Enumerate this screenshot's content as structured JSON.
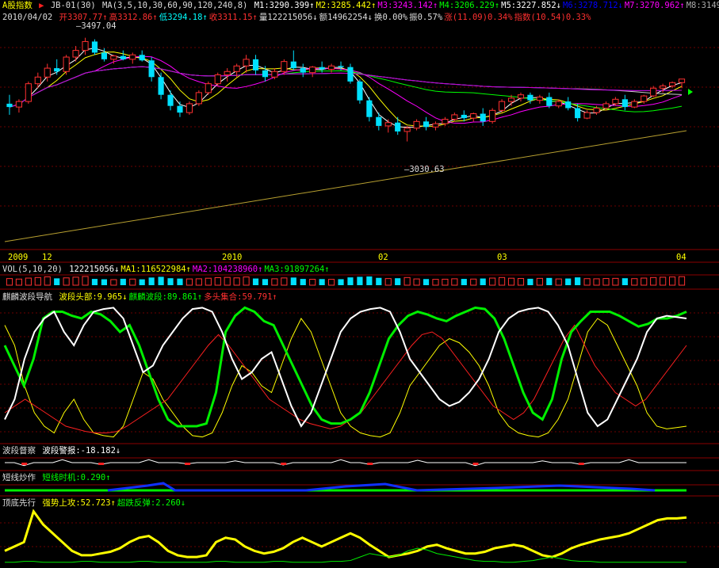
{
  "header": {
    "title": "A股指数",
    "formula": "JB-01(30)",
    "ma_label": "MA(3,5,10,30,60,90,120,240,8)",
    "ma_values": [
      {
        "text": "M1:3290.399",
        "arrow": "↑",
        "color": "#ffffff"
      },
      {
        "text": "M2:3285.442",
        "arrow": "↑",
        "color": "#ffff00"
      },
      {
        "text": "M3:3243.142",
        "arrow": "↑",
        "color": "#ff00ff"
      },
      {
        "text": "M4:3206.229",
        "arrow": "↑",
        "color": "#00ff00"
      },
      {
        "text": "M5:3227.852",
        "arrow": "↓",
        "color": "#ffffff"
      },
      {
        "text": "M6:3278.712",
        "arrow": "↓",
        "color": "#0000ff"
      },
      {
        "text": "M7:3270.962",
        "arrow": "↑",
        "color": "#ff00ff"
      },
      {
        "text": "M8:3149.",
        "arrow": "",
        "color": "#aaaaaa"
      }
    ],
    "date": "2010/04/02",
    "quote": [
      {
        "text": "开3307.77",
        "arrow": "↑",
        "color": "#ff3030"
      },
      {
        "text": "高3312.86",
        "arrow": "↑",
        "color": "#ff3030"
      },
      {
        "text": "低3294.18",
        "arrow": "↑",
        "color": "#00ffff"
      },
      {
        "text": "收3311.15",
        "arrow": "↑",
        "color": "#ff3030"
      },
      {
        "text": "量122215056",
        "arrow": "↓",
        "color": "#dddddd"
      },
      {
        "text": "额14962254",
        "arrow": "↓",
        "color": "#dddddd"
      },
      {
        "text": "换0.00%",
        "arrow": "",
        "color": "#dddddd"
      },
      {
        "text": "振0.57%",
        "arrow": "",
        "color": "#dddddd"
      },
      {
        "text": "涨(11.09)0.34%",
        "arrow": "",
        "color": "#ff3030"
      },
      {
        "text": "指数(10.54)0.33%",
        "arrow": "",
        "color": "#ff3030"
      }
    ]
  },
  "price_annotations": {
    "high": "3497.04",
    "low": "3030.63"
  },
  "time_axis": [
    "2009",
    "12",
    "2010",
    "02",
    "03",
    "04"
  ],
  "volume_panel": {
    "label": "VOL(5,10,20)",
    "items": [
      {
        "text": "122215056",
        "arrow": "↓",
        "color": "#ffffff"
      },
      {
        "text": "MA1:116522984",
        "arrow": "↑",
        "color": "#ffff00"
      },
      {
        "text": "MA2:104238960",
        "arrow": "↑",
        "color": "#ff00ff"
      },
      {
        "text": "MA3:91897264",
        "arrow": "↑",
        "color": "#00ff00"
      }
    ]
  },
  "wave_panel": {
    "label": "麒麟波段导航",
    "items": [
      {
        "text": "波段头部:9.965",
        "arrow": "↓",
        "color": "#ffff00"
      },
      {
        "text": "麒麟波段:89.861",
        "arrow": "↑",
        "color": "#00ff00"
      },
      {
        "text": "多头集合:59.791",
        "arrow": "↑",
        "color": "#ff3030"
      }
    ]
  },
  "watch_panel": {
    "label": "波段督察",
    "items": [
      {
        "text": "波段警报:-18.182",
        "arrow": "↓",
        "color": "#ffffff"
      }
    ]
  },
  "short_panel": {
    "label": "短线炒作",
    "items": [
      {
        "text": "短线时机:0.290",
        "arrow": "↑",
        "color": "#00ff00"
      }
    ]
  },
  "top_panel": {
    "label": "顶底先行",
    "items": [
      {
        "text": "强势上攻:52.723",
        "arrow": "↑",
        "color": "#ffff00"
      },
      {
        "text": "超跌反弹:2.260",
        "arrow": "↓",
        "color": "#00ff00"
      }
    ]
  },
  "chart_data": {
    "type": "candlestick",
    "ylim": [
      2900,
      3560
    ],
    "candles": [
      [
        3200,
        3240,
        3150,
        3185
      ],
      [
        3185,
        3220,
        3160,
        3210
      ],
      [
        3210,
        3300,
        3200,
        3290
      ],
      [
        3290,
        3340,
        3270,
        3320
      ],
      [
        3320,
        3380,
        3300,
        3360
      ],
      [
        3360,
        3400,
        3330,
        3345
      ],
      [
        3345,
        3420,
        3330,
        3410
      ],
      [
        3410,
        3460,
        3390,
        3440
      ],
      [
        3440,
        3497,
        3420,
        3480
      ],
      [
        3480,
        3490,
        3420,
        3430
      ],
      [
        3430,
        3450,
        3390,
        3400
      ],
      [
        3400,
        3420,
        3380,
        3415
      ],
      [
        3415,
        3440,
        3395,
        3400
      ],
      [
        3400,
        3430,
        3380,
        3420
      ],
      [
        3420,
        3440,
        3390,
        3395
      ],
      [
        3395,
        3410,
        3300,
        3320
      ],
      [
        3320,
        3340,
        3220,
        3240
      ],
      [
        3240,
        3260,
        3170,
        3190
      ],
      [
        3190,
        3210,
        3140,
        3160
      ],
      [
        3160,
        3210,
        3150,
        3200
      ],
      [
        3200,
        3260,
        3190,
        3250
      ],
      [
        3250,
        3300,
        3240,
        3290
      ],
      [
        3290,
        3340,
        3280,
        3330
      ],
      [
        3330,
        3360,
        3300,
        3345
      ],
      [
        3345,
        3380,
        3320,
        3370
      ],
      [
        3370,
        3420,
        3340,
        3400
      ],
      [
        3400,
        3420,
        3330,
        3350
      ],
      [
        3350,
        3370,
        3300,
        3320
      ],
      [
        3320,
        3360,
        3310,
        3345
      ],
      [
        3345,
        3400,
        3330,
        3390
      ],
      [
        3390,
        3440,
        3350,
        3360
      ],
      [
        3360,
        3380,
        3320,
        3340
      ],
      [
        3340,
        3370,
        3320,
        3365
      ],
      [
        3365,
        3390,
        3340,
        3355
      ],
      [
        3355,
        3380,
        3340,
        3370
      ],
      [
        3370,
        3390,
        3350,
        3365
      ],
      [
        3365,
        3380,
        3290,
        3300
      ],
      [
        3300,
        3310,
        3200,
        3215
      ],
      [
        3215,
        3230,
        3120,
        3140
      ],
      [
        3140,
        3160,
        3080,
        3100
      ],
      [
        3100,
        3130,
        3070,
        3115
      ],
      [
        3115,
        3140,
        3060,
        3075
      ],
      [
        3075,
        3100,
        3030,
        3090
      ],
      [
        3090,
        3130,
        3080,
        3120
      ],
      [
        3120,
        3140,
        3080,
        3095
      ],
      [
        3095,
        3120,
        3080,
        3110
      ],
      [
        3110,
        3140,
        3100,
        3130
      ],
      [
        3130,
        3160,
        3120,
        3150
      ],
      [
        3150,
        3170,
        3120,
        3135
      ],
      [
        3135,
        3160,
        3120,
        3155
      ],
      [
        3155,
        3180,
        3100,
        3120
      ],
      [
        3120,
        3180,
        3110,
        3170
      ],
      [
        3170,
        3220,
        3160,
        3210
      ],
      [
        3210,
        3240,
        3190,
        3225
      ],
      [
        3225,
        3250,
        3210,
        3240
      ],
      [
        3240,
        3250,
        3200,
        3215
      ],
      [
        3215,
        3240,
        3200,
        3230
      ],
      [
        3230,
        3250,
        3180,
        3190
      ],
      [
        3190,
        3220,
        3180,
        3210
      ],
      [
        3210,
        3230,
        3170,
        3180
      ],
      [
        3180,
        3200,
        3120,
        3135
      ],
      [
        3135,
        3170,
        3130,
        3160
      ],
      [
        3160,
        3190,
        3150,
        3180
      ],
      [
        3180,
        3210,
        3170,
        3200
      ],
      [
        3200,
        3230,
        3190,
        3220
      ],
      [
        3220,
        3240,
        3170,
        3185
      ],
      [
        3185,
        3220,
        3180,
        3210
      ],
      [
        3210,
        3240,
        3200,
        3235
      ],
      [
        3235,
        3280,
        3230,
        3270
      ],
      [
        3270,
        3290,
        3250,
        3280
      ],
      [
        3280,
        3300,
        3270,
        3295
      ],
      [
        3295,
        3312,
        3270,
        3311
      ]
    ],
    "volume": [
      95,
      88,
      102,
      110,
      120,
      98,
      105,
      115,
      125,
      90,
      85,
      80,
      92,
      88,
      84,
      110,
      120,
      100,
      95,
      90,
      92,
      100,
      108,
      112,
      105,
      118,
      96,
      88,
      92,
      104,
      110,
      90,
      85,
      88,
      84,
      86,
      112,
      120,
      125,
      105,
      95,
      100,
      110,
      90,
      88,
      84,
      86,
      92,
      90,
      88,
      96,
      102,
      110,
      100,
      96,
      92,
      98,
      104,
      90,
      96,
      112,
      94,
      92,
      96,
      98,
      100,
      94,
      102,
      110,
      114,
      118,
      122
    ],
    "volume_up": [
      1,
      1,
      1,
      1,
      1,
      0,
      1,
      1,
      1,
      0,
      0,
      1,
      0,
      1,
      0,
      0,
      0,
      0,
      0,
      1,
      1,
      1,
      1,
      1,
      1,
      1,
      0,
      0,
      1,
      1,
      0,
      0,
      1,
      0,
      1,
      0,
      0,
      0,
      0,
      0,
      1,
      0,
      1,
      1,
      0,
      1,
      1,
      1,
      0,
      1,
      0,
      1,
      1,
      1,
      1,
      0,
      1,
      0,
      1,
      0,
      0,
      1,
      1,
      1,
      1,
      0,
      1,
      1,
      1,
      1,
      1,
      1
    ],
    "wave_head": [
      85,
      70,
      40,
      20,
      10,
      5,
      20,
      30,
      15,
      5,
      3,
      2,
      10,
      30,
      50,
      45,
      30,
      20,
      10,
      3,
      2,
      5,
      20,
      40,
      55,
      50,
      40,
      35,
      55,
      75,
      90,
      80,
      60,
      40,
      20,
      10,
      5,
      3,
      2,
      5,
      20,
      40,
      50,
      60,
      70,
      75,
      72,
      65,
      55,
      40,
      20,
      10,
      5,
      3,
      2,
      5,
      15,
      30,
      55,
      80,
      90,
      85,
      70,
      55,
      40,
      20,
      10,
      8,
      9,
      10
    ],
    "qilin_wave": [
      70,
      55,
      40,
      60,
      90,
      95,
      95,
      92,
      90,
      95,
      93,
      88,
      80,
      85,
      70,
      50,
      30,
      15,
      10,
      10,
      10,
      12,
      35,
      80,
      92,
      98,
      95,
      88,
      85,
      70,
      55,
      40,
      25,
      15,
      12,
      12,
      15,
      20,
      35,
      55,
      75,
      85,
      92,
      95,
      93,
      90,
      88,
      92,
      95,
      98,
      97,
      90,
      75,
      55,
      35,
      20,
      15,
      30,
      60,
      80,
      88,
      95,
      95,
      95,
      92,
      88,
      84,
      86,
      90,
      90,
      92,
      95
    ],
    "bull_set": [
      20,
      25,
      30,
      25,
      20,
      15,
      10,
      8,
      6,
      5,
      5,
      6,
      10,
      15,
      20,
      25,
      30,
      40,
      50,
      60,
      70,
      78,
      70,
      60,
      50,
      40,
      30,
      25,
      20,
      15,
      12,
      10,
      8,
      10,
      15,
      20,
      30,
      40,
      50,
      60,
      70,
      78,
      80,
      75,
      65,
      55,
      45,
      35,
      25,
      20,
      15,
      20,
      30,
      45,
      60,
      75,
      85,
      70,
      55,
      45,
      35,
      30,
      25,
      30,
      40,
      50,
      60,
      70
    ],
    "alert": [
      0,
      0,
      -5,
      0,
      0,
      0,
      5,
      0,
      0,
      0,
      -3,
      0,
      0,
      0,
      0,
      5,
      0,
      0,
      0,
      -2,
      0,
      0,
      0,
      0,
      3,
      0,
      0,
      0,
      0,
      -4,
      0,
      0,
      0,
      0,
      0,
      5,
      0,
      0,
      -3,
      0,
      0,
      0,
      0,
      4,
      0,
      0,
      0,
      0,
      0,
      -5,
      0,
      0,
      0,
      0,
      0,
      0,
      3,
      0,
      0,
      0,
      -3,
      0,
      0,
      0,
      0,
      5,
      0,
      0,
      0,
      0,
      0,
      0
    ],
    "strong": [
      15,
      20,
      25,
      60,
      45,
      35,
      25,
      15,
      10,
      10,
      12,
      14,
      18,
      25,
      30,
      32,
      25,
      15,
      10,
      8,
      8,
      10,
      25,
      30,
      28,
      20,
      15,
      12,
      14,
      18,
      25,
      30,
      25,
      20,
      25,
      30,
      35,
      30,
      22,
      15,
      8,
      10,
      12,
      15,
      20,
      22,
      18,
      15,
      12,
      12,
      14,
      18,
      20,
      22,
      20,
      15,
      10,
      8,
      12,
      18,
      22,
      25,
      28,
      30,
      32,
      35,
      40,
      45,
      50,
      52,
      52,
      53
    ],
    "rebound": [
      2,
      2,
      3,
      3,
      2,
      2,
      2,
      2,
      3,
      3,
      2,
      2,
      2,
      2,
      3,
      3,
      2,
      2,
      2,
      2,
      2,
      2,
      3,
      3,
      2,
      2,
      2,
      2,
      3,
      3,
      2,
      2,
      2,
      2,
      3,
      3,
      4,
      8,
      12,
      10,
      8,
      10,
      15,
      18,
      16,
      12,
      10,
      8,
      6,
      4,
      3,
      3,
      2,
      2,
      3,
      4,
      6,
      8,
      6,
      4,
      3,
      3,
      2,
      2,
      2,
      2,
      2,
      2,
      2,
      2,
      2,
      2
    ]
  }
}
